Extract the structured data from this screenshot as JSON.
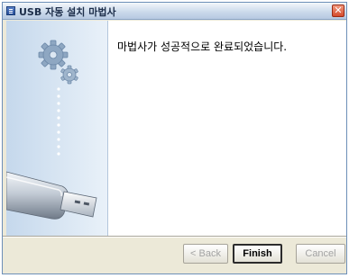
{
  "window": {
    "title": "USB 자동 설치 마법사",
    "close_glyph": "✕"
  },
  "content": {
    "message": "마법사가 성공적으로 완료되었습니다."
  },
  "buttons": {
    "back": "< Back",
    "finish": "Finish",
    "cancel": "Cancel"
  },
  "icons": {
    "title": "wizard-app-icon",
    "gears": "gears-icon",
    "usb": "usb-drive-icon",
    "close": "close-icon"
  },
  "colors": {
    "titlebar": "#c9d8ea",
    "sidepanel": "#c5d8ec",
    "window_bg": "#ece9d8",
    "close_button": "#d44a2b"
  }
}
